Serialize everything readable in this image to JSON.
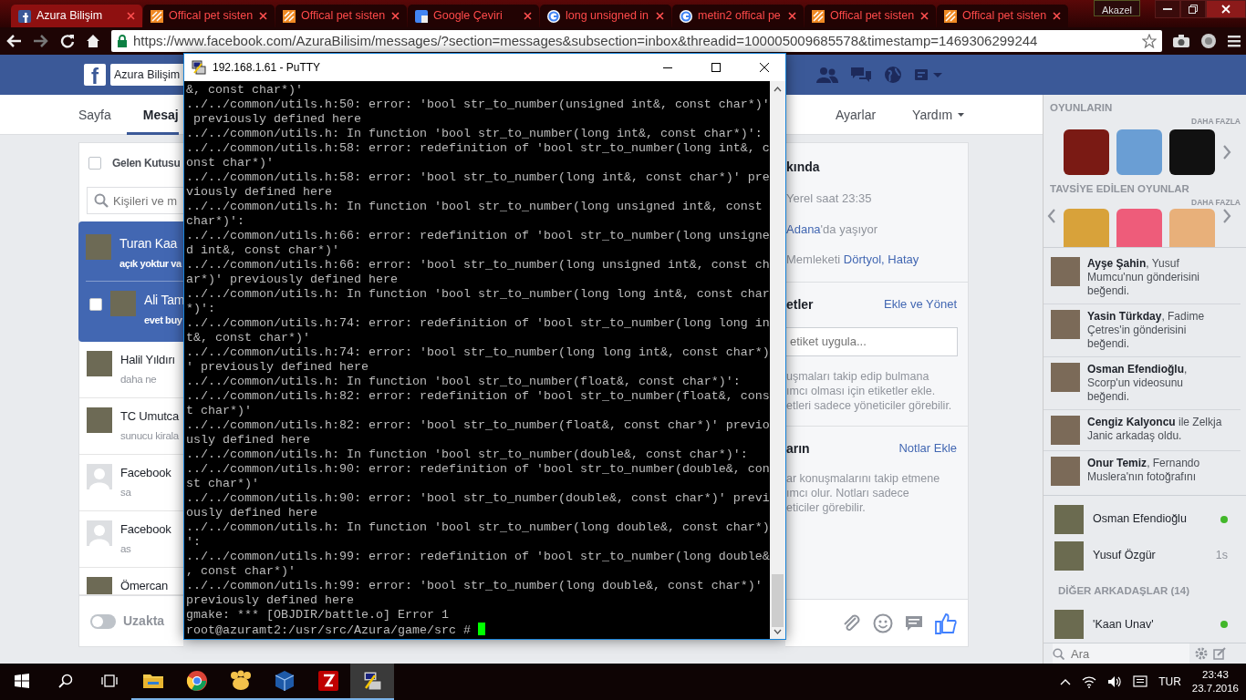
{
  "browser": {
    "tabs": [
      {
        "title": "Azura Bilişim",
        "kind": "facebook",
        "selected": true
      },
      {
        "title": "Offical pet sisten",
        "kind": "pet",
        "selected": false
      },
      {
        "title": "Offical pet sisten",
        "kind": "pet",
        "selected": false
      },
      {
        "title": "Google Çeviri",
        "kind": "translate",
        "selected": false
      },
      {
        "title": "long unsigned in",
        "kind": "google",
        "selected": false
      },
      {
        "title": "metin2 offical pe",
        "kind": "google",
        "selected": false
      },
      {
        "title": "Offical pet sisten",
        "kind": "pet",
        "selected": false
      },
      {
        "title": "Offical pet sisten",
        "kind": "pet",
        "selected": false
      }
    ],
    "profile": "Akazel",
    "url": "https://www.facebook.com/AzuraBilisim/messages/?section=messages&subsection=inbox&threadid=100005009685578&timestamp=1469306299244"
  },
  "facebook": {
    "logo": "f",
    "page_name": "Azura Bilişim",
    "nav_left": [
      {
        "label": "Sayfa",
        "selected": false
      },
      {
        "label": "Mesaj",
        "selected": true
      }
    ],
    "nav_right": [
      {
        "label": "Ayarlar",
        "dropdown": false
      },
      {
        "label": "Yardım",
        "dropdown": true
      }
    ],
    "inbox": {
      "folder": "Gelen Kutusu",
      "folder_checked": false,
      "search_placeholder": "Kişileri ve m",
      "threads": [
        {
          "name": "Turan Kaa",
          "snippet": "açık yoktur va",
          "kind": "photo",
          "selected": true
        },
        {
          "name": "Ali Tam",
          "snippet": "evet buy",
          "kind": "photo",
          "selected": true,
          "checkbox": {
            "checked": false
          }
        },
        {
          "name": "Halil Yıldırı",
          "snippet": "daha ne",
          "kind": "photo",
          "selected": false
        },
        {
          "name": "TC Umutca",
          "snippet": "sunucu kirala",
          "kind": "photo",
          "selected": false
        },
        {
          "name": "Facebook",
          "snippet": "sa",
          "kind": "silhouette",
          "selected": false
        },
        {
          "name": "Facebook",
          "snippet": "as",
          "kind": "silhouette",
          "selected": false
        },
        {
          "name": "Ömercan",
          "kind": "photo",
          "selected": false
        }
      ],
      "status": {
        "label": "Uzakta",
        "on": false
      }
    },
    "details": {
      "about_title": "kında",
      "local_time": "Yerel saat 23:35",
      "city": "Adana",
      "city_suffix": "'da yaşıyor",
      "hometown_prefix": "Memleketi",
      "hometown": "Dörtyol, Hatay",
      "tags": {
        "title": "etler",
        "action": "Ekle ve Yönet",
        "placeholder": "etiket uygula...",
        "help": [
          "uşmaları takip edip bulmana",
          "ımcı olması için etiketler ekle.",
          "etleri sadece yöneticiler görebilir."
        ]
      },
      "notes": {
        "title": "arın",
        "action": "Notlar Ekle",
        "help": [
          "ar konuşmalarını takip etmene",
          "ımcı olur. Notları sadece",
          "eticiler görebilir."
        ]
      }
    }
  },
  "sidebar": {
    "games": [
      {
        "title": "OYUNLARIN",
        "more": "DAHA FAZLA",
        "prev": false,
        "next": true
      },
      {
        "title": "TAVSİYE EDİLEN OYUNLAR",
        "more": "DAHA FAZLA",
        "prev": true,
        "next": true
      }
    ],
    "ticker": [
      "**Ayşe Şahin**, Yusuf Mumcu'nun gönderisini beğendi.",
      "**Yasin Türkday**, Fadime Çetres'in gönderisini beğendi.",
      "**Osman Efendioğlu**, Scorp'un videosunu beğendi.",
      "**Cengiz Kalyoncu** ile Zelkja Janic arkadaş oldu.",
      "**Onur Temiz**, Fernando Muslera'nın fotoğrafını"
    ],
    "chat": [
      {
        "name": "Osman Efendioğlu",
        "online": true
      },
      {
        "name": "Yusuf Özgür",
        "online": false,
        "idle": "1s"
      }
    ],
    "other_header": "DİĞER ARKADAŞLAR (14)",
    "others": [
      {
        "name": "'Kaan Unav'",
        "online": true
      }
    ],
    "search_placeholder": "Ara"
  },
  "putty": {
    "title": "192.168.1.61 - PuTTY",
    "lines": [
      "&, const char*)'",
      "../../common/utils.h:50: error: 'bool str_to_number(unsigned int&, const char*)'",
      " previously defined here",
      "../../common/utils.h: In function 'bool str_to_number(long int&, const char*)':",
      "../../common/utils.h:58: error: redefinition of 'bool str_to_number(long int&, c",
      "onst char*)'",
      "../../common/utils.h:58: error: 'bool str_to_number(long int&, const char*)' pre",
      "viously defined here",
      "../../common/utils.h: In function 'bool str_to_number(long unsigned int&, const",
      "char*)':",
      "../../common/utils.h:66: error: redefinition of 'bool str_to_number(long unsigne",
      "d int&, const char*)'",
      "../../common/utils.h:66: error: 'bool str_to_number(long unsigned int&, const ch",
      "ar*)' previously defined here",
      "../../common/utils.h: In function 'bool str_to_number(long long int&, const char",
      "*)':",
      "../../common/utils.h:74: error: redefinition of 'bool str_to_number(long long in",
      "t&, const char*)'",
      "../../common/utils.h:74: error: 'bool str_to_number(long long int&, const char*)",
      "' previously defined here",
      "../../common/utils.h: In function 'bool str_to_number(float&, const char*)':",
      "../../common/utils.h:82: error: redefinition of 'bool str_to_number(float&, cons",
      "t char*)'",
      "../../common/utils.h:82: error: 'bool str_to_number(float&, const char*)' previo",
      "usly defined here",
      "../../common/utils.h: In function 'bool str_to_number(double&, const char*)':",
      "../../common/utils.h:90: error: redefinition of 'bool str_to_number(double&, con",
      "st char*)'",
      "../../common/utils.h:90: error: 'bool str_to_number(double&, const char*)' previ",
      "ously defined here",
      "../../common/utils.h: In function 'bool str_to_number(long double&, const char*)",
      "':",
      "../../common/utils.h:99: error: redefinition of 'bool str_to_number(long double&",
      ", const char*)'",
      "../../common/utils.h:99: error: 'bool str_to_number(long double&, const char*)'",
      "previously defined here",
      "gmake: *** [OBJDIR/battle.o] Error 1"
    ],
    "prompt": "root@azuramt2:/usr/src/Azura/game/src #"
  },
  "taskbar": {
    "apps": [
      {
        "kind": "explorer",
        "active": false
      },
      {
        "kind": "chrome",
        "active": false
      },
      {
        "kind": "paw",
        "active": false
      },
      {
        "kind": "vbox",
        "active": false
      },
      {
        "kind": "filezilla",
        "active": false
      },
      {
        "kind": "putty",
        "active": true
      }
    ],
    "language": "TUR",
    "time": "23:43",
    "date": "23.7.2016"
  }
}
